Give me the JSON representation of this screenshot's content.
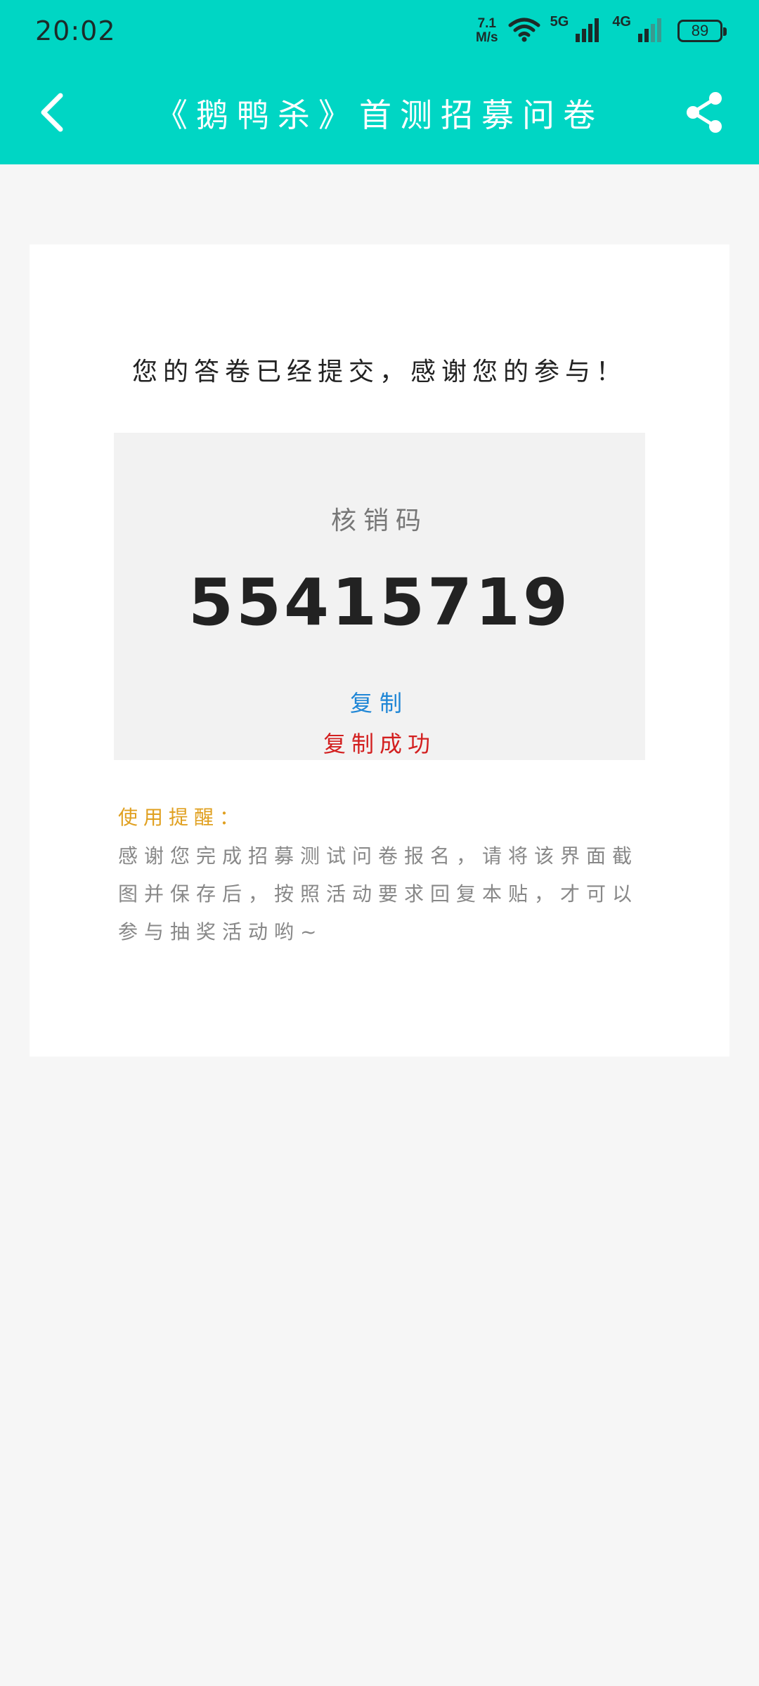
{
  "status_bar": {
    "time": "20:02",
    "speed_value": "7.1",
    "speed_unit": "M/s",
    "net_5g": "5G",
    "net_4g": "4G",
    "battery": "89"
  },
  "header": {
    "title": "《鹅鸭杀》首测招募问卷"
  },
  "card": {
    "thanks": "您的答卷已经提交，感谢您的参与！",
    "code_label": "核销码",
    "code_value": "55415719",
    "copy_label": "复制",
    "copy_success": "复制成功",
    "reminder_title": "使用提醒：",
    "reminder_body": "感谢您完成招募测试问卷报名，请将该界面截图并保存后，按照活动要求回复本贴，才可以参与抽奖活动哟~"
  },
  "colors": {
    "header_bg": "#00d6c4",
    "copy_link": "#1e86d6",
    "copy_success": "#d32020",
    "reminder_title": "#e0a020"
  }
}
